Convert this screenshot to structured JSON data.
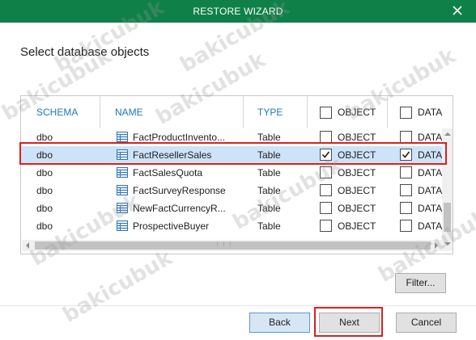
{
  "window": {
    "title": "RESTORE WIZARD"
  },
  "page": {
    "heading": "Select database objects"
  },
  "grid": {
    "columns": {
      "schema": "SCHEMA",
      "name": "NAME",
      "type": "TYPE",
      "object": "OBJECT",
      "data": "DATA"
    },
    "rows": [
      {
        "schema": "dbo",
        "name": "FactProductInvento...",
        "type": "Table",
        "object_label": "OBJECT",
        "data_label": "DATA",
        "object_checked": false,
        "data_checked": false,
        "selected": false
      },
      {
        "schema": "dbo",
        "name": "FactResellerSales",
        "type": "Table",
        "object_label": "OBJECT",
        "data_label": "DATA",
        "object_checked": true,
        "data_checked": true,
        "selected": true
      },
      {
        "schema": "dbo",
        "name": "FactSalesQuota",
        "type": "Table",
        "object_label": "OBJECT",
        "data_label": "DATA",
        "object_checked": false,
        "data_checked": false,
        "selected": false
      },
      {
        "schema": "dbo",
        "name": "FactSurveyResponse",
        "type": "Table",
        "object_label": "OBJECT",
        "data_label": "DATA",
        "object_checked": false,
        "data_checked": false,
        "selected": false
      },
      {
        "schema": "dbo",
        "name": "NewFactCurrencyR...",
        "type": "Table",
        "object_label": "OBJECT",
        "data_label": "DATA",
        "object_checked": false,
        "data_checked": false,
        "selected": false
      },
      {
        "schema": "dbo",
        "name": "ProspectiveBuyer",
        "type": "Table",
        "object_label": "OBJECT",
        "data_label": "DATA",
        "object_checked": false,
        "data_checked": false,
        "selected": false
      }
    ]
  },
  "buttons": {
    "filter": "Filter...",
    "back": "Back",
    "next": "Next",
    "cancel": "Cancel"
  },
  "watermark": {
    "text": "bakicubuk"
  },
  "colors": {
    "titlebar": "#0f8048",
    "header_text": "#1e7ab4",
    "selected_row": "#cde3f7",
    "highlight": "#d92020"
  }
}
